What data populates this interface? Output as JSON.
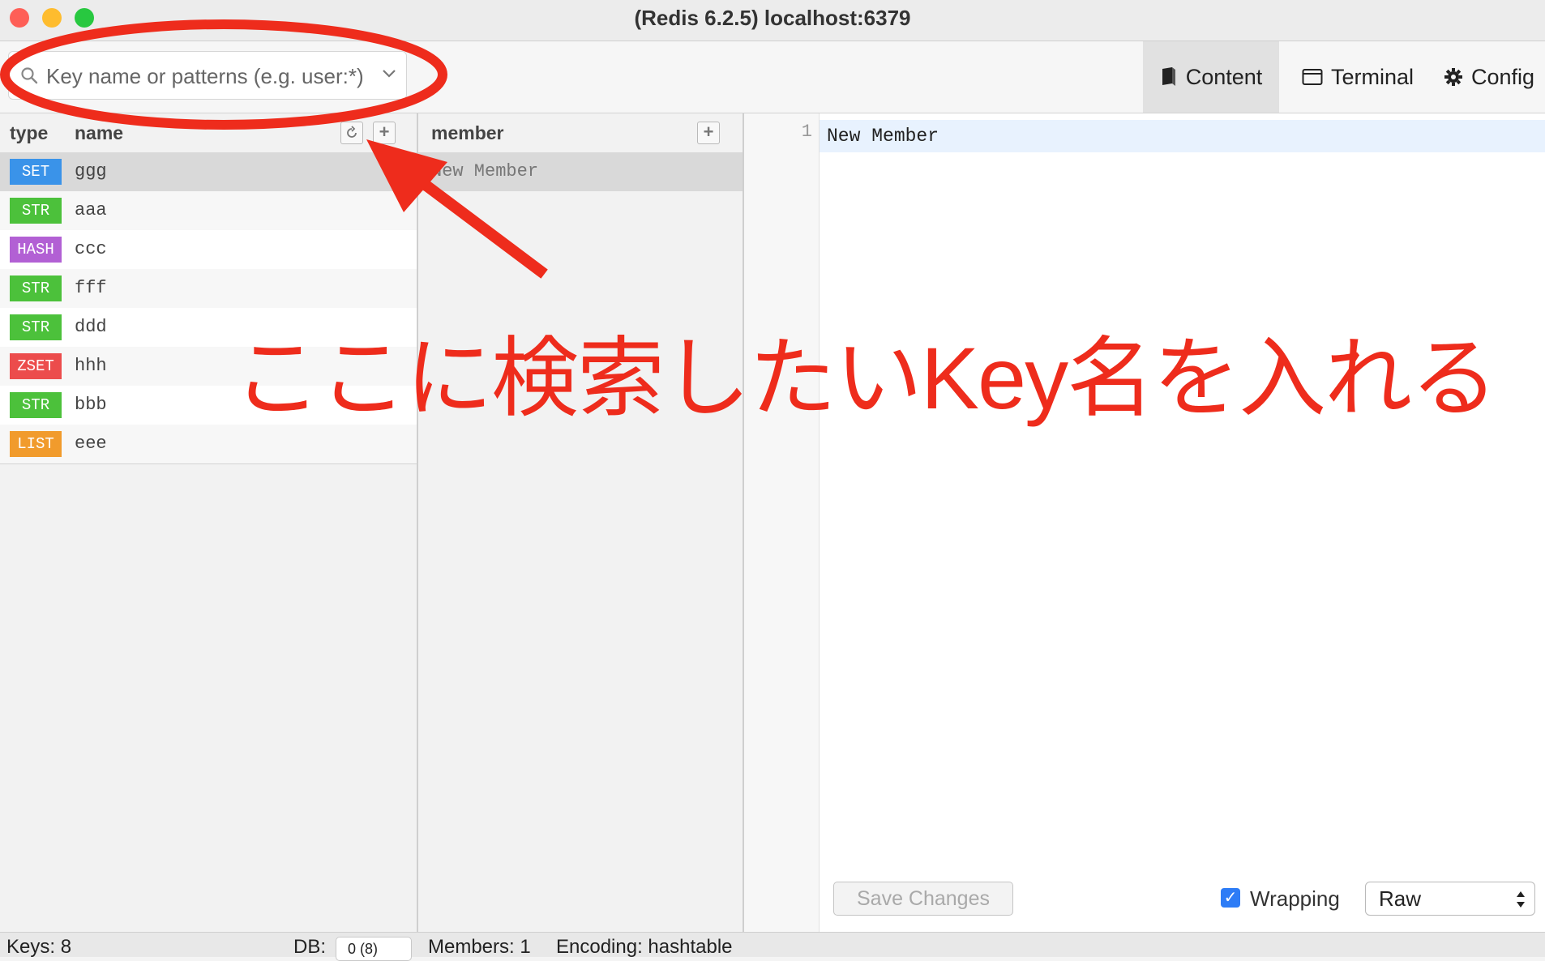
{
  "window": {
    "title": "(Redis 6.2.5) localhost:6379"
  },
  "search": {
    "placeholder": "Key name or patterns (e.g. user:*)"
  },
  "toolbar": {
    "content": "Content",
    "terminal": "Terminal",
    "config": "Config"
  },
  "keys_panel": {
    "col_type": "type",
    "col_name": "name",
    "rows": [
      {
        "type": "SET",
        "name": "ggg",
        "color": "#3a93e9"
      },
      {
        "type": "STR",
        "name": "aaa",
        "color": "#4cc13b"
      },
      {
        "type": "HASH",
        "name": "ccc",
        "color": "#b260d4"
      },
      {
        "type": "STR",
        "name": "fff",
        "color": "#4cc13b"
      },
      {
        "type": "STR",
        "name": "ddd",
        "color": "#4cc13b"
      },
      {
        "type": "ZSET",
        "name": "hhh",
        "color": "#ec4c4c"
      },
      {
        "type": "STR",
        "name": "bbb",
        "color": "#4cc13b"
      },
      {
        "type": "LIST",
        "name": "eee",
        "color": "#f19b2c"
      }
    ]
  },
  "members_panel": {
    "header": "member",
    "rows": [
      "New Member"
    ]
  },
  "editor": {
    "line_number": "1",
    "content": "New Member"
  },
  "footer": {
    "save_label": "Save Changes",
    "wrapping_label": "Wrapping",
    "wrapping_checked": true,
    "format_value": "Raw"
  },
  "status": {
    "keys": "Keys: 8",
    "db_label": "DB:",
    "db_value": "0 (8)",
    "members": "Members: 1",
    "encoding": "Encoding: hashtable"
  },
  "annotation": {
    "text": "ここに検索したいKey名を入れる",
    "color": "#ee2c1c"
  }
}
